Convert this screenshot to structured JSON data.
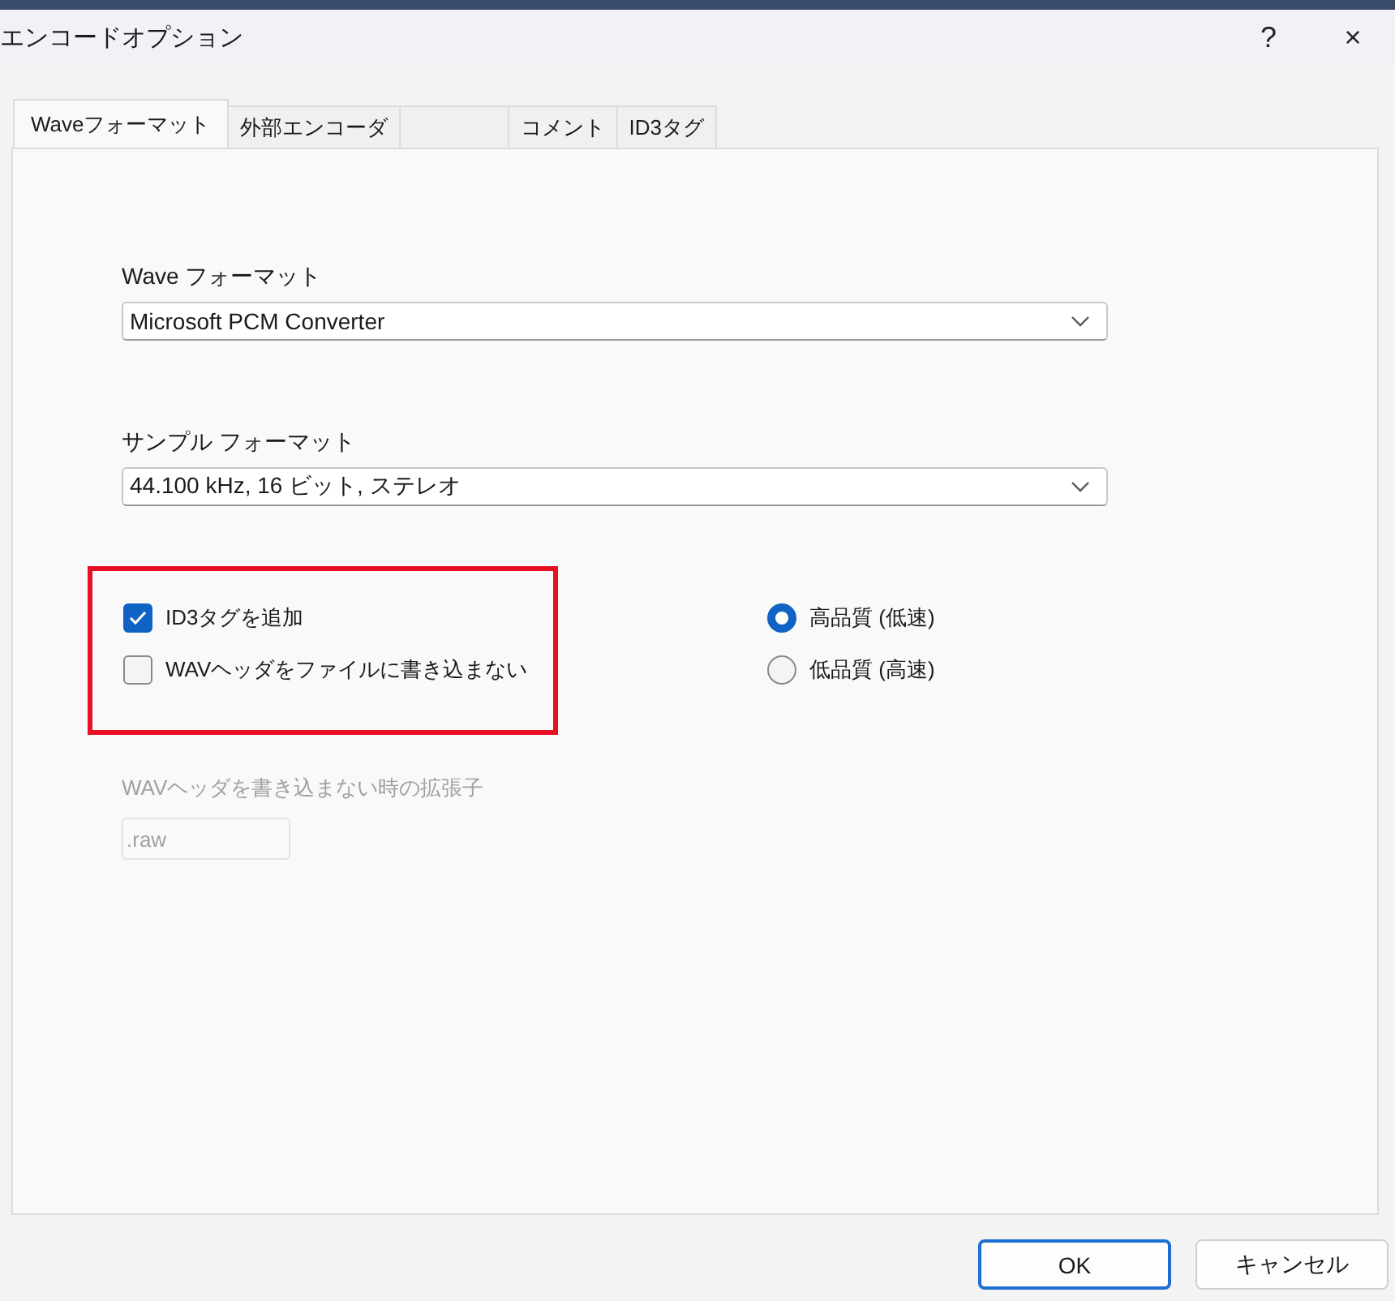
{
  "window": {
    "title": "エンコードオプション",
    "help": "?",
    "close": "×"
  },
  "tabs": [
    {
      "label": "Waveフォーマット",
      "selected": true
    },
    {
      "label": "外部エンコーダ",
      "selected": false
    },
    {
      "selected": false
    },
    {
      "label": "コメント",
      "selected": false
    },
    {
      "label": "ID3タグ",
      "selected": false
    }
  ],
  "fields": [
    {
      "label": "Wave フォーマット",
      "value": "Microsoft PCM Converter"
    },
    {
      "label": "サンプル フォーマット",
      "value": "44.100 kHz, 16 ビット, ステレオ"
    }
  ],
  "checkboxes": {
    "highlighted": true,
    "items": [
      {
        "label": "ID3タグを追加",
        "checked": true
      },
      {
        "label": "WAVヘッダをファイルに書き込まない",
        "checked": false
      }
    ]
  },
  "radios": [
    {
      "label": "高品質 (低速)",
      "selected": true
    },
    {
      "label": "低品質 (高速)",
      "selected": false
    }
  ],
  "extension": {
    "label": "WAVヘッダを書き込まない時の拡張子",
    "value": ".raw",
    "disabled": true
  },
  "buttons": [
    {
      "label": "OK",
      "default": true
    },
    {
      "label": "キャンセル",
      "default": false
    }
  ]
}
